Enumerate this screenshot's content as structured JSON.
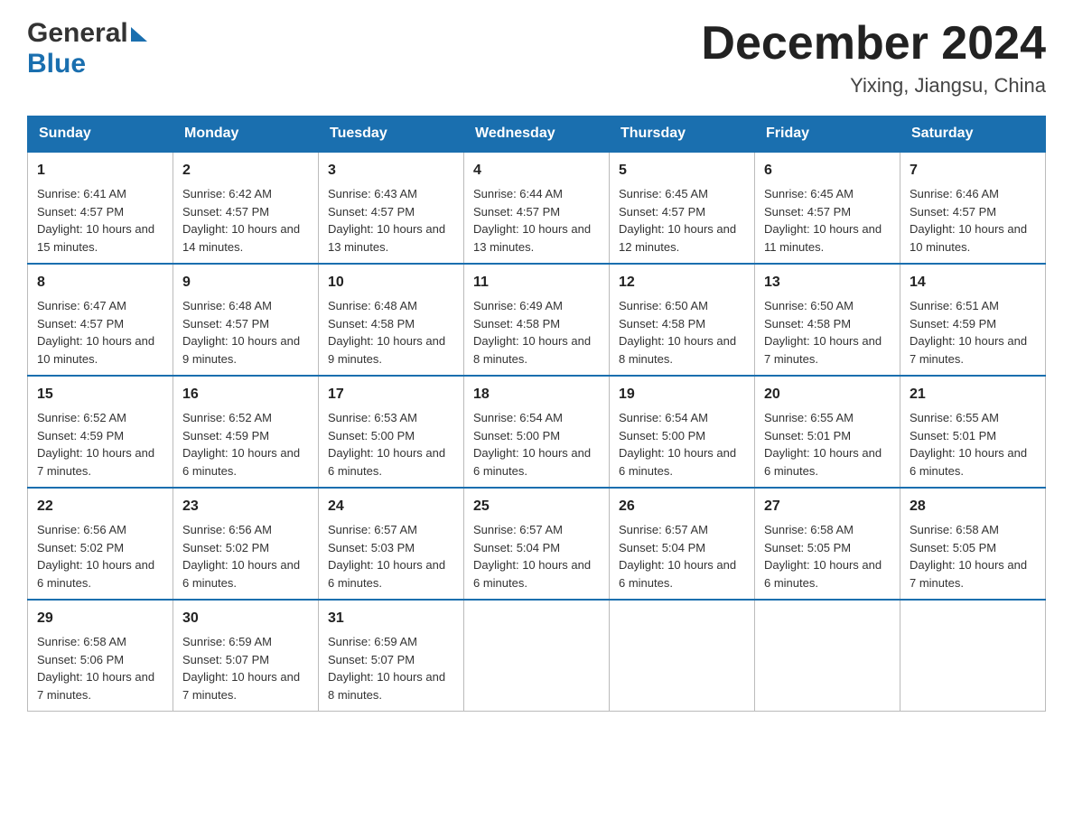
{
  "header": {
    "logo_general": "General",
    "logo_blue": "Blue",
    "month_title": "December 2024",
    "location": "Yixing, Jiangsu, China"
  },
  "days_of_week": [
    "Sunday",
    "Monday",
    "Tuesday",
    "Wednesday",
    "Thursday",
    "Friday",
    "Saturday"
  ],
  "weeks": [
    [
      {
        "day": "1",
        "sunrise": "6:41 AM",
        "sunset": "4:57 PM",
        "daylight": "10 hours and 15 minutes."
      },
      {
        "day": "2",
        "sunrise": "6:42 AM",
        "sunset": "4:57 PM",
        "daylight": "10 hours and 14 minutes."
      },
      {
        "day": "3",
        "sunrise": "6:43 AM",
        "sunset": "4:57 PM",
        "daylight": "10 hours and 13 minutes."
      },
      {
        "day": "4",
        "sunrise": "6:44 AM",
        "sunset": "4:57 PM",
        "daylight": "10 hours and 13 minutes."
      },
      {
        "day": "5",
        "sunrise": "6:45 AM",
        "sunset": "4:57 PM",
        "daylight": "10 hours and 12 minutes."
      },
      {
        "day": "6",
        "sunrise": "6:45 AM",
        "sunset": "4:57 PM",
        "daylight": "10 hours and 11 minutes."
      },
      {
        "day": "7",
        "sunrise": "6:46 AM",
        "sunset": "4:57 PM",
        "daylight": "10 hours and 10 minutes."
      }
    ],
    [
      {
        "day": "8",
        "sunrise": "6:47 AM",
        "sunset": "4:57 PM",
        "daylight": "10 hours and 10 minutes."
      },
      {
        "day": "9",
        "sunrise": "6:48 AM",
        "sunset": "4:57 PM",
        "daylight": "10 hours and 9 minutes."
      },
      {
        "day": "10",
        "sunrise": "6:48 AM",
        "sunset": "4:58 PM",
        "daylight": "10 hours and 9 minutes."
      },
      {
        "day": "11",
        "sunrise": "6:49 AM",
        "sunset": "4:58 PM",
        "daylight": "10 hours and 8 minutes."
      },
      {
        "day": "12",
        "sunrise": "6:50 AM",
        "sunset": "4:58 PM",
        "daylight": "10 hours and 8 minutes."
      },
      {
        "day": "13",
        "sunrise": "6:50 AM",
        "sunset": "4:58 PM",
        "daylight": "10 hours and 7 minutes."
      },
      {
        "day": "14",
        "sunrise": "6:51 AM",
        "sunset": "4:59 PM",
        "daylight": "10 hours and 7 minutes."
      }
    ],
    [
      {
        "day": "15",
        "sunrise": "6:52 AM",
        "sunset": "4:59 PM",
        "daylight": "10 hours and 7 minutes."
      },
      {
        "day": "16",
        "sunrise": "6:52 AM",
        "sunset": "4:59 PM",
        "daylight": "10 hours and 6 minutes."
      },
      {
        "day": "17",
        "sunrise": "6:53 AM",
        "sunset": "5:00 PM",
        "daylight": "10 hours and 6 minutes."
      },
      {
        "day": "18",
        "sunrise": "6:54 AM",
        "sunset": "5:00 PM",
        "daylight": "10 hours and 6 minutes."
      },
      {
        "day": "19",
        "sunrise": "6:54 AM",
        "sunset": "5:00 PM",
        "daylight": "10 hours and 6 minutes."
      },
      {
        "day": "20",
        "sunrise": "6:55 AM",
        "sunset": "5:01 PM",
        "daylight": "10 hours and 6 minutes."
      },
      {
        "day": "21",
        "sunrise": "6:55 AM",
        "sunset": "5:01 PM",
        "daylight": "10 hours and 6 minutes."
      }
    ],
    [
      {
        "day": "22",
        "sunrise": "6:56 AM",
        "sunset": "5:02 PM",
        "daylight": "10 hours and 6 minutes."
      },
      {
        "day": "23",
        "sunrise": "6:56 AM",
        "sunset": "5:02 PM",
        "daylight": "10 hours and 6 minutes."
      },
      {
        "day": "24",
        "sunrise": "6:57 AM",
        "sunset": "5:03 PM",
        "daylight": "10 hours and 6 minutes."
      },
      {
        "day": "25",
        "sunrise": "6:57 AM",
        "sunset": "5:04 PM",
        "daylight": "10 hours and 6 minutes."
      },
      {
        "day": "26",
        "sunrise": "6:57 AM",
        "sunset": "5:04 PM",
        "daylight": "10 hours and 6 minutes."
      },
      {
        "day": "27",
        "sunrise": "6:58 AM",
        "sunset": "5:05 PM",
        "daylight": "10 hours and 6 minutes."
      },
      {
        "day": "28",
        "sunrise": "6:58 AM",
        "sunset": "5:05 PM",
        "daylight": "10 hours and 7 minutes."
      }
    ],
    [
      {
        "day": "29",
        "sunrise": "6:58 AM",
        "sunset": "5:06 PM",
        "daylight": "10 hours and 7 minutes."
      },
      {
        "day": "30",
        "sunrise": "6:59 AM",
        "sunset": "5:07 PM",
        "daylight": "10 hours and 7 minutes."
      },
      {
        "day": "31",
        "sunrise": "6:59 AM",
        "sunset": "5:07 PM",
        "daylight": "10 hours and 8 minutes."
      },
      null,
      null,
      null,
      null
    ]
  ],
  "labels": {
    "sunrise": "Sunrise:",
    "sunset": "Sunset:",
    "daylight": "Daylight:"
  }
}
